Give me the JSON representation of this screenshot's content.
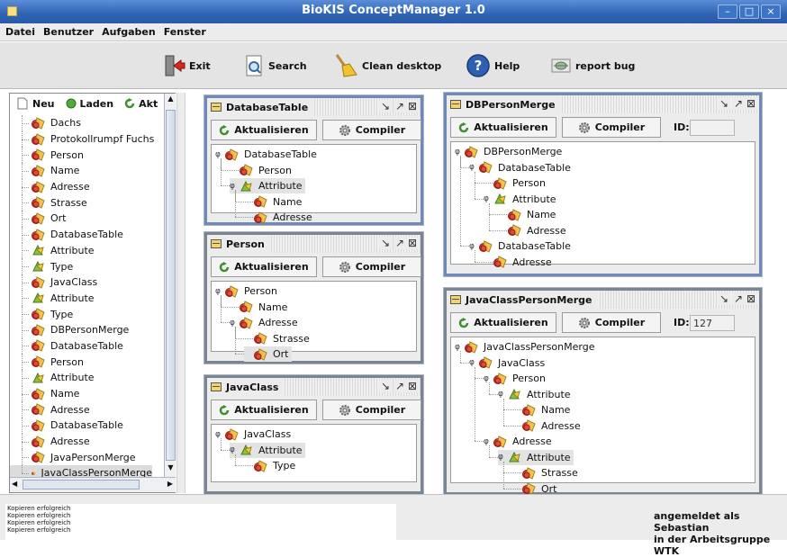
{
  "window": {
    "title": "BioKIS ConceptManager 1.0"
  },
  "menu": [
    "Datei",
    "Benutzer",
    "Aufgaben",
    "Fenster"
  ],
  "toolbar": {
    "exit": "Exit",
    "search": "Search",
    "clean": "Clean desktop",
    "help": "Help",
    "report": "report bug"
  },
  "left": {
    "buttons": {
      "neu": "Neu",
      "laden": "Laden",
      "akt": "Akt"
    },
    "items": [
      {
        "label": "Dachs",
        "type": "red"
      },
      {
        "label": "Protokollrumpf Fuchs",
        "type": "red"
      },
      {
        "label": "Person",
        "type": "red"
      },
      {
        "label": "Name",
        "type": "red"
      },
      {
        "label": "Adresse",
        "type": "red"
      },
      {
        "label": "Strasse",
        "type": "red"
      },
      {
        "label": "Ort",
        "type": "red"
      },
      {
        "label": "DatabaseTable",
        "type": "red"
      },
      {
        "label": "Attribute",
        "type": "green"
      },
      {
        "label": "Type",
        "type": "green"
      },
      {
        "label": "JavaClass",
        "type": "red"
      },
      {
        "label": "Attribute",
        "type": "green"
      },
      {
        "label": "Type",
        "type": "red"
      },
      {
        "label": "DBPersonMerge",
        "type": "red"
      },
      {
        "label": "DatabaseTable",
        "type": "red"
      },
      {
        "label": "Person",
        "type": "red"
      },
      {
        "label": "Attribute",
        "type": "green"
      },
      {
        "label": "Name",
        "type": "red"
      },
      {
        "label": "Adresse",
        "type": "red"
      },
      {
        "label": "DatabaseTable",
        "type": "red"
      },
      {
        "label": "Adresse",
        "type": "red"
      },
      {
        "label": "JavaPersonMerge",
        "type": "red"
      },
      {
        "label": "JavaClassPersonMerge",
        "type": "red",
        "selected": true
      }
    ]
  },
  "frames": {
    "common": {
      "aktualisieren": "Aktualisieren",
      "compiler": "Compiler",
      "id_label": "ID:"
    },
    "databasetable": {
      "title": "DatabaseTable",
      "nodes": [
        {
          "label": "DatabaseTable",
          "type": "red",
          "depth": 0,
          "toggle": true
        },
        {
          "label": "Person",
          "type": "red",
          "depth": 1
        },
        {
          "label": "Attribute",
          "type": "green",
          "depth": 1,
          "toggle": true,
          "hl": true
        },
        {
          "label": "Name",
          "type": "red",
          "depth": 2
        },
        {
          "label": "Adresse",
          "type": "red",
          "depth": 2
        }
      ]
    },
    "person": {
      "title": "Person",
      "nodes": [
        {
          "label": "Person",
          "type": "red",
          "depth": 0,
          "toggle": true
        },
        {
          "label": "Name",
          "type": "red",
          "depth": 1
        },
        {
          "label": "Adresse",
          "type": "red",
          "depth": 1,
          "toggle": true
        },
        {
          "label": "Strasse",
          "type": "red",
          "depth": 2
        },
        {
          "label": "Ort",
          "type": "red",
          "depth": 2,
          "hl": true
        }
      ]
    },
    "javaclass": {
      "title": "JavaClass",
      "nodes": [
        {
          "label": "JavaClass",
          "type": "red",
          "depth": 0,
          "toggle": true
        },
        {
          "label": "Attribute",
          "type": "green",
          "depth": 1,
          "toggle": true,
          "hl": true
        },
        {
          "label": "Type",
          "type": "red",
          "depth": 2
        }
      ]
    },
    "dbpersonmerge": {
      "title": "DBPersonMerge",
      "id_value": "",
      "nodes": [
        {
          "label": "DBPersonMerge",
          "type": "red",
          "depth": 0,
          "toggle": true
        },
        {
          "label": "DatabaseTable",
          "type": "red",
          "depth": 1,
          "toggle": true
        },
        {
          "label": "Person",
          "type": "red",
          "depth": 2
        },
        {
          "label": "Attribute",
          "type": "green",
          "depth": 2,
          "toggle": true
        },
        {
          "label": "Name",
          "type": "red",
          "depth": 3
        },
        {
          "label": "Adresse",
          "type": "red",
          "depth": 3
        },
        {
          "label": "DatabaseTable",
          "type": "red",
          "depth": 1,
          "toggle": true
        },
        {
          "label": "Adresse",
          "type": "red",
          "depth": 2
        }
      ]
    },
    "javaclasspersonmerge": {
      "title": "JavaClassPersonMerge",
      "id_value": "127",
      "nodes": [
        {
          "label": "JavaClassPersonMerge",
          "type": "red",
          "depth": 0,
          "toggle": true
        },
        {
          "label": "JavaClass",
          "type": "red",
          "depth": 1,
          "toggle": true
        },
        {
          "label": "Person",
          "type": "red",
          "depth": 2,
          "toggle": true
        },
        {
          "label": "Attribute",
          "type": "green",
          "depth": 3,
          "toggle": true
        },
        {
          "label": "Name",
          "type": "red",
          "depth": 4
        },
        {
          "label": "Adresse",
          "type": "red",
          "depth": 4
        },
        {
          "label": "Adresse",
          "type": "red",
          "depth": 2,
          "toggle": true
        },
        {
          "label": "Attribute",
          "type": "green",
          "depth": 3,
          "toggle": true,
          "hl": true
        },
        {
          "label": "Strasse",
          "type": "red",
          "depth": 4
        },
        {
          "label": "Ort",
          "type": "red",
          "depth": 4
        }
      ]
    }
  },
  "status": {
    "log": [
      "Kopieren erfolgreich",
      "Kopieren erfolgreich",
      "Kopieren erfolgreich",
      "Kopieren erfolgreich"
    ],
    "login_line1": "angemeldet als Sebastian",
    "login_line2": "in der Arbeitsgruppe WTK"
  }
}
